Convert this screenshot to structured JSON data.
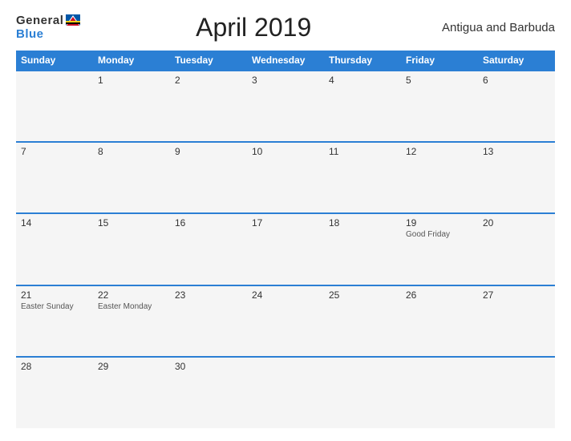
{
  "header": {
    "logo_general": "General",
    "logo_blue": "Blue",
    "title": "April 2019",
    "country": "Antigua and Barbuda"
  },
  "weekdays": [
    "Sunday",
    "Monday",
    "Tuesday",
    "Wednesday",
    "Thursday",
    "Friday",
    "Saturday"
  ],
  "weeks": [
    [
      {
        "day": "",
        "event": ""
      },
      {
        "day": "1",
        "event": ""
      },
      {
        "day": "2",
        "event": ""
      },
      {
        "day": "3",
        "event": ""
      },
      {
        "day": "4",
        "event": ""
      },
      {
        "day": "5",
        "event": ""
      },
      {
        "day": "6",
        "event": ""
      }
    ],
    [
      {
        "day": "7",
        "event": ""
      },
      {
        "day": "8",
        "event": ""
      },
      {
        "day": "9",
        "event": ""
      },
      {
        "day": "10",
        "event": ""
      },
      {
        "day": "11",
        "event": ""
      },
      {
        "day": "12",
        "event": ""
      },
      {
        "day": "13",
        "event": ""
      }
    ],
    [
      {
        "day": "14",
        "event": ""
      },
      {
        "day": "15",
        "event": ""
      },
      {
        "day": "16",
        "event": ""
      },
      {
        "day": "17",
        "event": ""
      },
      {
        "day": "18",
        "event": ""
      },
      {
        "day": "19",
        "event": "Good Friday"
      },
      {
        "day": "20",
        "event": ""
      }
    ],
    [
      {
        "day": "21",
        "event": "Easter Sunday"
      },
      {
        "day": "22",
        "event": "Easter Monday"
      },
      {
        "day": "23",
        "event": ""
      },
      {
        "day": "24",
        "event": ""
      },
      {
        "day": "25",
        "event": ""
      },
      {
        "day": "26",
        "event": ""
      },
      {
        "day": "27",
        "event": ""
      }
    ],
    [
      {
        "day": "28",
        "event": ""
      },
      {
        "day": "29",
        "event": ""
      },
      {
        "day": "30",
        "event": ""
      },
      {
        "day": "",
        "event": ""
      },
      {
        "day": "",
        "event": ""
      },
      {
        "day": "",
        "event": ""
      },
      {
        "day": "",
        "event": ""
      }
    ]
  ]
}
